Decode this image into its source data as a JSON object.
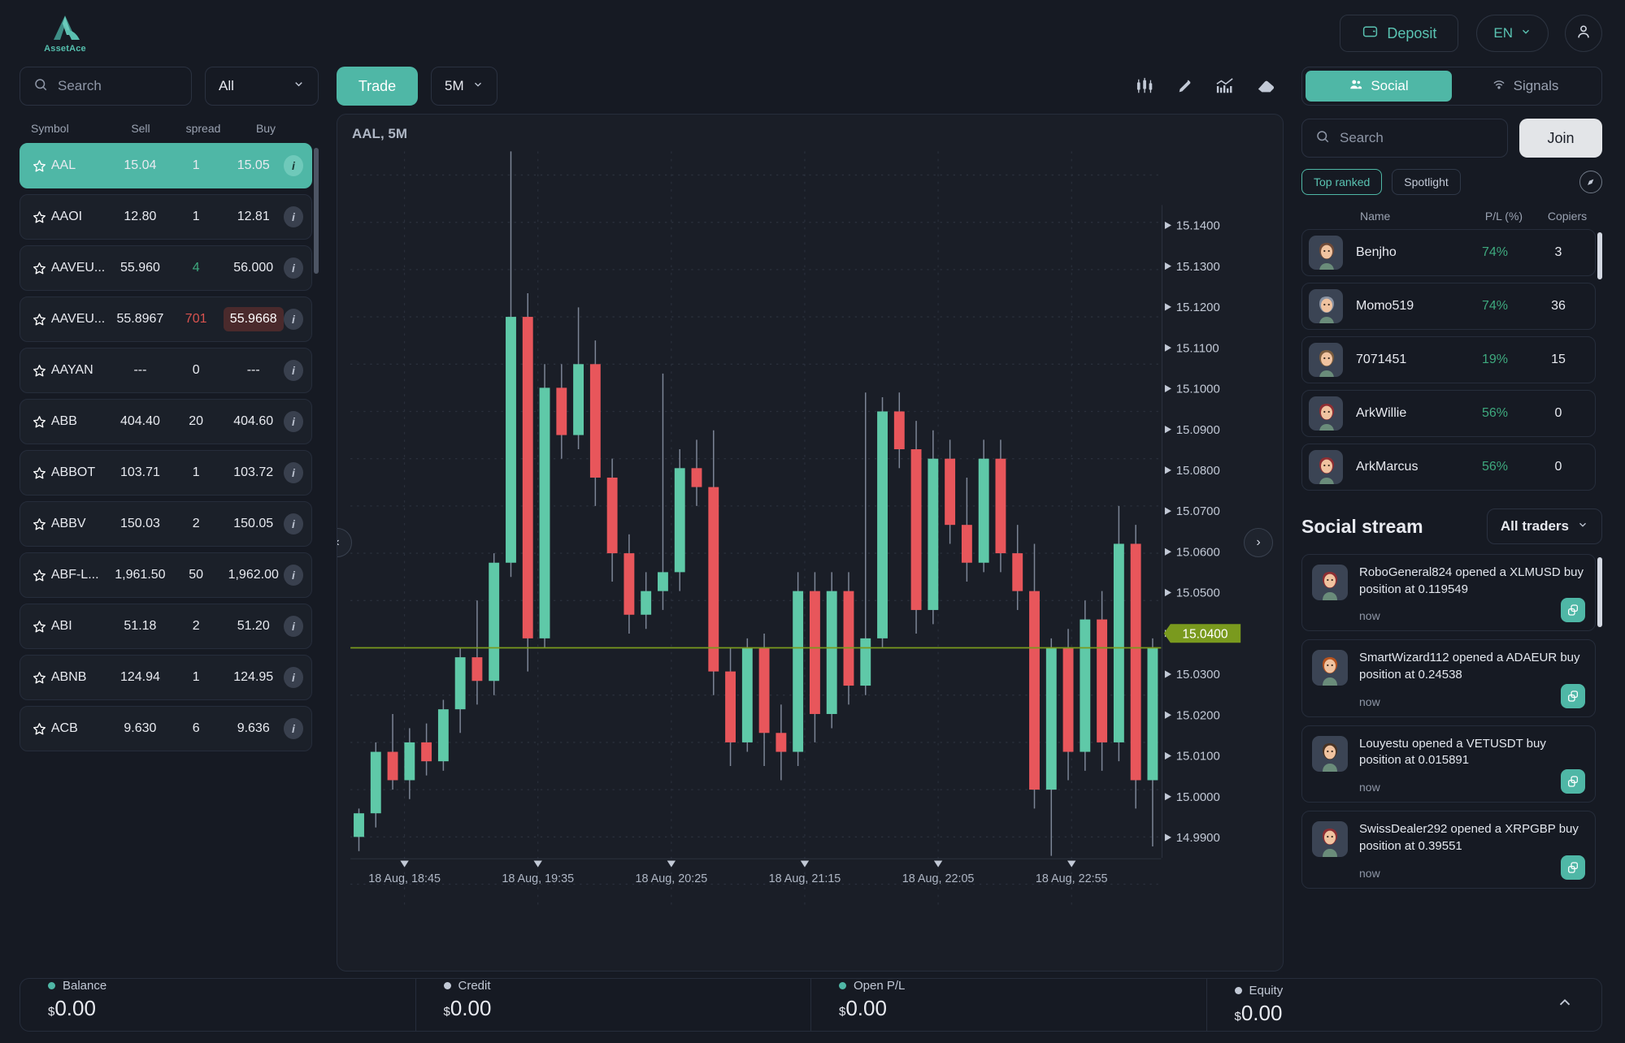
{
  "header": {
    "brand": "AssetAce",
    "deposit_label": "Deposit",
    "lang_label": "EN"
  },
  "watchlist": {
    "search_placeholder": "Search",
    "filter_value": "All",
    "columns": {
      "symbol": "Symbol",
      "sell": "Sell",
      "spread": "spread",
      "buy": "Buy"
    },
    "rows": [
      {
        "symbol": "AAL",
        "sell": "15.04",
        "spread": "1",
        "buy": "15.05",
        "active": true,
        "spread_color": "white",
        "buy_highlight": false
      },
      {
        "symbol": "AAOI",
        "sell": "12.80",
        "spread": "1",
        "buy": "12.81",
        "active": false,
        "spread_color": "white",
        "buy_highlight": false
      },
      {
        "symbol": "AAVEU...",
        "sell": "55.960",
        "spread": "4",
        "buy": "56.000",
        "active": false,
        "spread_color": "green",
        "buy_highlight": false
      },
      {
        "symbol": "AAVEU...",
        "sell": "55.8967",
        "spread": "701",
        "buy": "55.9668",
        "active": false,
        "spread_color": "red",
        "buy_highlight": true
      },
      {
        "symbol": "AAYAN",
        "sell": "---",
        "spread": "0",
        "buy": "---",
        "active": false,
        "spread_color": "white",
        "buy_highlight": false
      },
      {
        "symbol": "ABB",
        "sell": "404.40",
        "spread": "20",
        "buy": "404.60",
        "active": false,
        "spread_color": "white",
        "buy_highlight": false
      },
      {
        "symbol": "ABBOT",
        "sell": "103.71",
        "spread": "1",
        "buy": "103.72",
        "active": false,
        "spread_color": "white",
        "buy_highlight": false
      },
      {
        "symbol": "ABBV",
        "sell": "150.03",
        "spread": "2",
        "buy": "150.05",
        "active": false,
        "spread_color": "white",
        "buy_highlight": false
      },
      {
        "symbol": "ABF-L...",
        "sell": "1,961.50",
        "spread": "50",
        "buy": "1,962.00",
        "active": false,
        "spread_color": "white",
        "buy_highlight": false
      },
      {
        "symbol": "ABI",
        "sell": "51.18",
        "spread": "2",
        "buy": "51.20",
        "active": false,
        "spread_color": "white",
        "buy_highlight": false
      },
      {
        "symbol": "ABNB",
        "sell": "124.94",
        "spread": "1",
        "buy": "124.95",
        "active": false,
        "spread_color": "white",
        "buy_highlight": false
      },
      {
        "symbol": "ACB",
        "sell": "9.630",
        "spread": "6",
        "buy": "9.636",
        "active": false,
        "spread_color": "white",
        "buy_highlight": false
      }
    ]
  },
  "chart_toolbar": {
    "trade_label": "Trade",
    "timeframe": "5M"
  },
  "chart_data": {
    "type": "candlestick",
    "title": "AAL, 5M",
    "symbol": "AAL",
    "timeframe": "5M",
    "ylabel": "",
    "xlabel": "",
    "ylim": [
      14.985,
      15.145
    ],
    "price_ticks": [
      "15.1400",
      "15.1300",
      "15.1200",
      "15.1100",
      "15.1000",
      "15.0900",
      "15.0800",
      "15.0700",
      "15.0600",
      "15.0500",
      "15.0400",
      "15.0300",
      "15.0200",
      "15.0100",
      "15.0000",
      "14.9900"
    ],
    "time_ticks": [
      "18 Aug, 18:45",
      "18 Aug, 19:35",
      "18 Aug, 20:25",
      "18 Aug, 21:15",
      "18 Aug, 22:05",
      "18 Aug, 22:55"
    ],
    "current_price": "15.0400",
    "current_price_color": "#7A9A1E",
    "up_color": "#5FC9A8",
    "down_color": "#E8565B",
    "grid": true,
    "candles": [
      {
        "o": 15.0,
        "h": 15.006,
        "l": 14.997,
        "c": 15.005
      },
      {
        "o": 15.005,
        "h": 15.02,
        "l": 15.002,
        "c": 15.018
      },
      {
        "o": 15.018,
        "h": 15.026,
        "l": 15.01,
        "c": 15.012
      },
      {
        "o": 15.012,
        "h": 15.023,
        "l": 15.008,
        "c": 15.02
      },
      {
        "o": 15.02,
        "h": 15.024,
        "l": 15.013,
        "c": 15.016
      },
      {
        "o": 15.016,
        "h": 15.029,
        "l": 15.014,
        "c": 15.027
      },
      {
        "o": 15.027,
        "h": 15.04,
        "l": 15.022,
        "c": 15.038
      },
      {
        "o": 15.038,
        "h": 15.05,
        "l": 15.028,
        "c": 15.033
      },
      {
        "o": 15.033,
        "h": 15.06,
        "l": 15.03,
        "c": 15.058
      },
      {
        "o": 15.058,
        "h": 15.145,
        "l": 15.055,
        "c": 15.11
      },
      {
        "o": 15.11,
        "h": 15.115,
        "l": 15.035,
        "c": 15.042
      },
      {
        "o": 15.042,
        "h": 15.1,
        "l": 15.04,
        "c": 15.095
      },
      {
        "o": 15.095,
        "h": 15.1,
        "l": 15.08,
        "c": 15.085
      },
      {
        "o": 15.085,
        "h": 15.112,
        "l": 15.082,
        "c": 15.1
      },
      {
        "o": 15.1,
        "h": 15.105,
        "l": 15.07,
        "c": 15.076
      },
      {
        "o": 15.076,
        "h": 15.08,
        "l": 15.054,
        "c": 15.06
      },
      {
        "o": 15.06,
        "h": 15.064,
        "l": 15.043,
        "c": 15.047
      },
      {
        "o": 15.047,
        "h": 15.056,
        "l": 15.044,
        "c": 15.052
      },
      {
        "o": 15.052,
        "h": 15.098,
        "l": 15.048,
        "c": 15.056
      },
      {
        "o": 15.056,
        "h": 15.082,
        "l": 15.052,
        "c": 15.078
      },
      {
        "o": 15.078,
        "h": 15.084,
        "l": 15.07,
        "c": 15.074
      },
      {
        "o": 15.074,
        "h": 15.086,
        "l": 15.03,
        "c": 15.035
      },
      {
        "o": 15.035,
        "h": 15.04,
        "l": 15.015,
        "c": 15.02
      },
      {
        "o": 15.02,
        "h": 15.042,
        "l": 15.018,
        "c": 15.04
      },
      {
        "o": 15.04,
        "h": 15.043,
        "l": 15.015,
        "c": 15.022
      },
      {
        "o": 15.022,
        "h": 15.028,
        "l": 15.012,
        "c": 15.018
      },
      {
        "o": 15.018,
        "h": 15.056,
        "l": 15.015,
        "c": 15.052
      },
      {
        "o": 15.052,
        "h": 15.056,
        "l": 15.02,
        "c": 15.026
      },
      {
        "o": 15.026,
        "h": 15.056,
        "l": 15.023,
        "c": 15.052
      },
      {
        "o": 15.052,
        "h": 15.056,
        "l": 15.028,
        "c": 15.032
      },
      {
        "o": 15.032,
        "h": 15.094,
        "l": 15.03,
        "c": 15.042
      },
      {
        "o": 15.042,
        "h": 15.093,
        "l": 15.04,
        "c": 15.09
      },
      {
        "o": 15.09,
        "h": 15.094,
        "l": 15.078,
        "c": 15.082
      },
      {
        "o": 15.082,
        "h": 15.088,
        "l": 15.043,
        "c": 15.048
      },
      {
        "o": 15.048,
        "h": 15.086,
        "l": 15.045,
        "c": 15.08
      },
      {
        "o": 15.08,
        "h": 15.084,
        "l": 15.062,
        "c": 15.066
      },
      {
        "o": 15.066,
        "h": 15.076,
        "l": 15.054,
        "c": 15.058
      },
      {
        "o": 15.058,
        "h": 15.084,
        "l": 15.056,
        "c": 15.08
      },
      {
        "o": 15.08,
        "h": 15.084,
        "l": 15.056,
        "c": 15.06
      },
      {
        "o": 15.06,
        "h": 15.066,
        "l": 15.048,
        "c": 15.052
      },
      {
        "o": 15.052,
        "h": 15.062,
        "l": 15.006,
        "c": 15.01
      },
      {
        "o": 15.01,
        "h": 15.042,
        "l": 14.996,
        "c": 15.04
      },
      {
        "o": 15.04,
        "h": 15.044,
        "l": 15.012,
        "c": 15.018
      },
      {
        "o": 15.018,
        "h": 15.05,
        "l": 15.014,
        "c": 15.046
      },
      {
        "o": 15.046,
        "h": 15.052,
        "l": 15.014,
        "c": 15.02
      },
      {
        "o": 15.02,
        "h": 15.07,
        "l": 15.016,
        "c": 15.062
      },
      {
        "o": 15.062,
        "h": 15.066,
        "l": 15.006,
        "c": 15.012
      },
      {
        "o": 15.012,
        "h": 15.042,
        "l": 14.998,
        "c": 15.04
      }
    ]
  },
  "social": {
    "tabs": [
      {
        "label": "Social",
        "icon": "people-icon",
        "active": true
      },
      {
        "label": "Signals",
        "icon": "wifi-icon",
        "active": false
      }
    ],
    "search_placeholder": "Search",
    "join_label": "Join",
    "chips": [
      {
        "label": "Top ranked",
        "active": true
      },
      {
        "label": "Spotlight",
        "active": false
      }
    ],
    "leaderboard_columns": {
      "name": "Name",
      "pl": "P/L (%)",
      "copiers": "Copiers"
    },
    "leaderboard": [
      {
        "name": "Benjho",
        "pl": "74%",
        "copiers": "3",
        "avatar": "#6E4A38"
      },
      {
        "name": "Momo519",
        "pl": "74%",
        "copiers": "36",
        "avatar": "#8A93A3"
      },
      {
        "name": "7071451",
        "pl": "19%",
        "copiers": "15",
        "avatar": "#7A5C3E"
      },
      {
        "name": "ArkWillie",
        "pl": "56%",
        "copiers": "0",
        "avatar": "#8E2E33"
      },
      {
        "name": "ArkMarcus",
        "pl": "56%",
        "copiers": "0",
        "avatar": "#8E2E33"
      }
    ],
    "stream_title": "Social stream",
    "stream_filter": "All traders",
    "stream": [
      {
        "text": "RoboGeneral824 opened a XLMUSD buy position at 0.119549",
        "time": "now",
        "avatar": "#8E2E33"
      },
      {
        "text": "SmartWizard112 opened a ADAEUR buy position at 0.24538",
        "time": "now",
        "avatar": "#B5531F"
      },
      {
        "text": "Louyestu opened a VETUSDT buy position at 0.015891",
        "time": "now",
        "avatar": "#4A3424"
      },
      {
        "text": "SwissDealer292 opened a XRPGBP buy position at 0.39551",
        "time": "now",
        "avatar": "#8E2E33"
      }
    ]
  },
  "account": {
    "cells": [
      {
        "label": "Balance",
        "currency": "$",
        "value": "0.00",
        "dot": "#4FB7A6"
      },
      {
        "label": "Credit",
        "currency": "$",
        "value": "0.00",
        "dot": "#C2C9D6"
      },
      {
        "label": "Open P/L",
        "currency": "$",
        "value": "0.00",
        "dot": "#4FB7A6"
      },
      {
        "label": "Equity",
        "currency": "$",
        "value": "0.00",
        "dot": "#C2C9D6"
      }
    ]
  }
}
